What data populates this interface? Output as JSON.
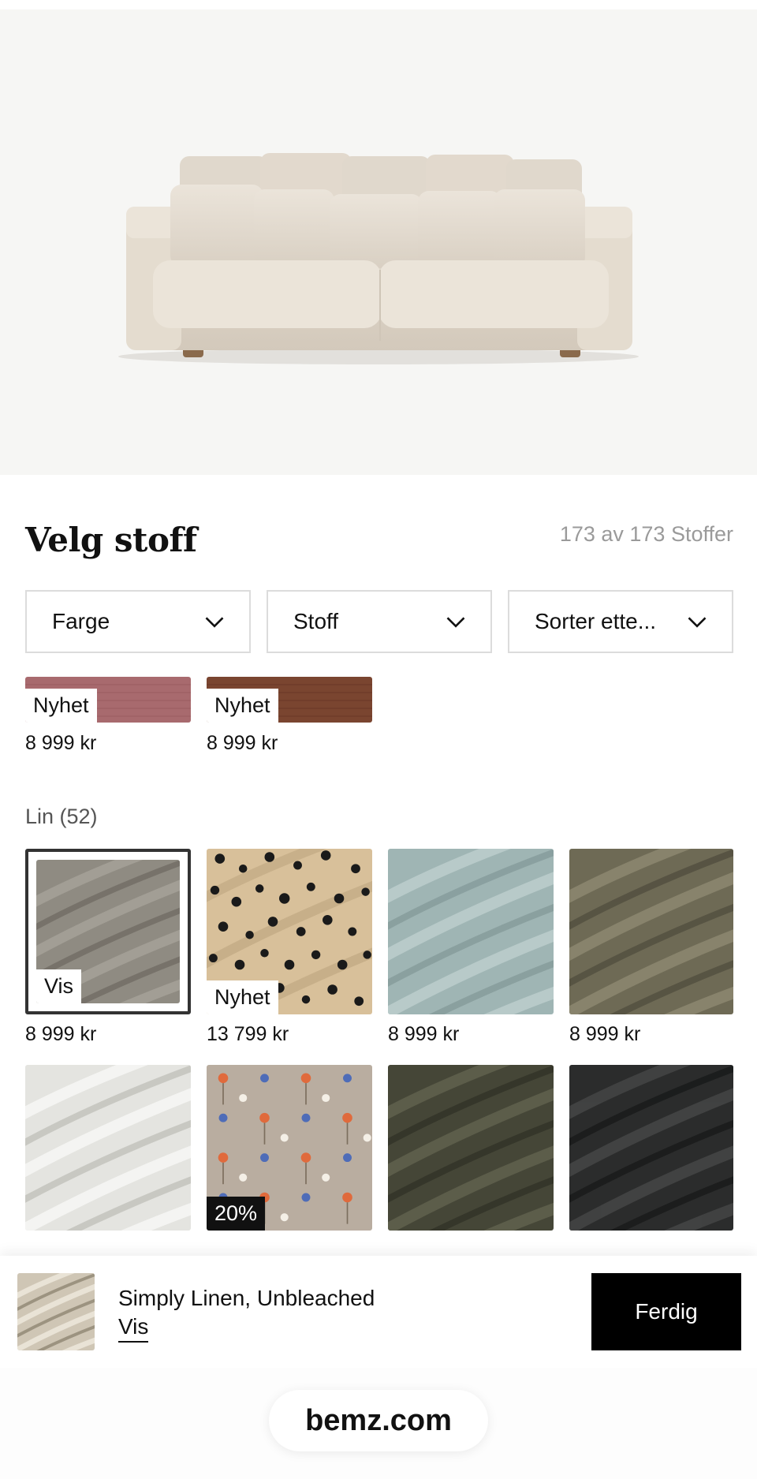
{
  "page": {
    "title": "Velg stoff",
    "count": "173 av 173 Stoffer"
  },
  "filters": [
    {
      "label": "Farge"
    },
    {
      "label": "Stoff"
    },
    {
      "label": "Sorter ette..."
    }
  ],
  "top_row": [
    {
      "tag": "Nyhet",
      "price": "8 999 kr",
      "color": "#a86a6e"
    },
    {
      "tag": "Nyhet",
      "price": "8 999 kr",
      "color": "#7a4530"
    }
  ],
  "section": {
    "label": "Lin (52)"
  },
  "grid": [
    {
      "tag": "Vis",
      "price": "8 999 kr",
      "color": "#8f8b82",
      "selected": true
    },
    {
      "tag": "Nyhet",
      "price": "13 799 kr",
      "color": "#d8c09a",
      "pattern": "dots"
    },
    {
      "tag": "",
      "price": "8 999 kr",
      "color": "#9fb5b4"
    },
    {
      "tag": "",
      "price": "8 999 kr",
      "color": "#6e6a55"
    },
    {
      "tag": "",
      "price": "",
      "color": "#e4e4e0"
    },
    {
      "tag": "20%",
      "price": "",
      "color": "#b9ada0",
      "pattern": "flowers"
    },
    {
      "tag": "",
      "price": "",
      "color": "#454637"
    },
    {
      "tag": "",
      "price": "",
      "color": "#2b2c2c"
    }
  ],
  "bottom_bar": {
    "fabric_name": "Simply Linen, Unbleached",
    "view_link": "Vis",
    "done_button": "Ferdig"
  },
  "url_bar": {
    "domain": "bemz.com"
  },
  "colors": {
    "hero_bg": "#f6f6f4",
    "button_bg": "#000000",
    "sofa": "#e3dbd0"
  }
}
